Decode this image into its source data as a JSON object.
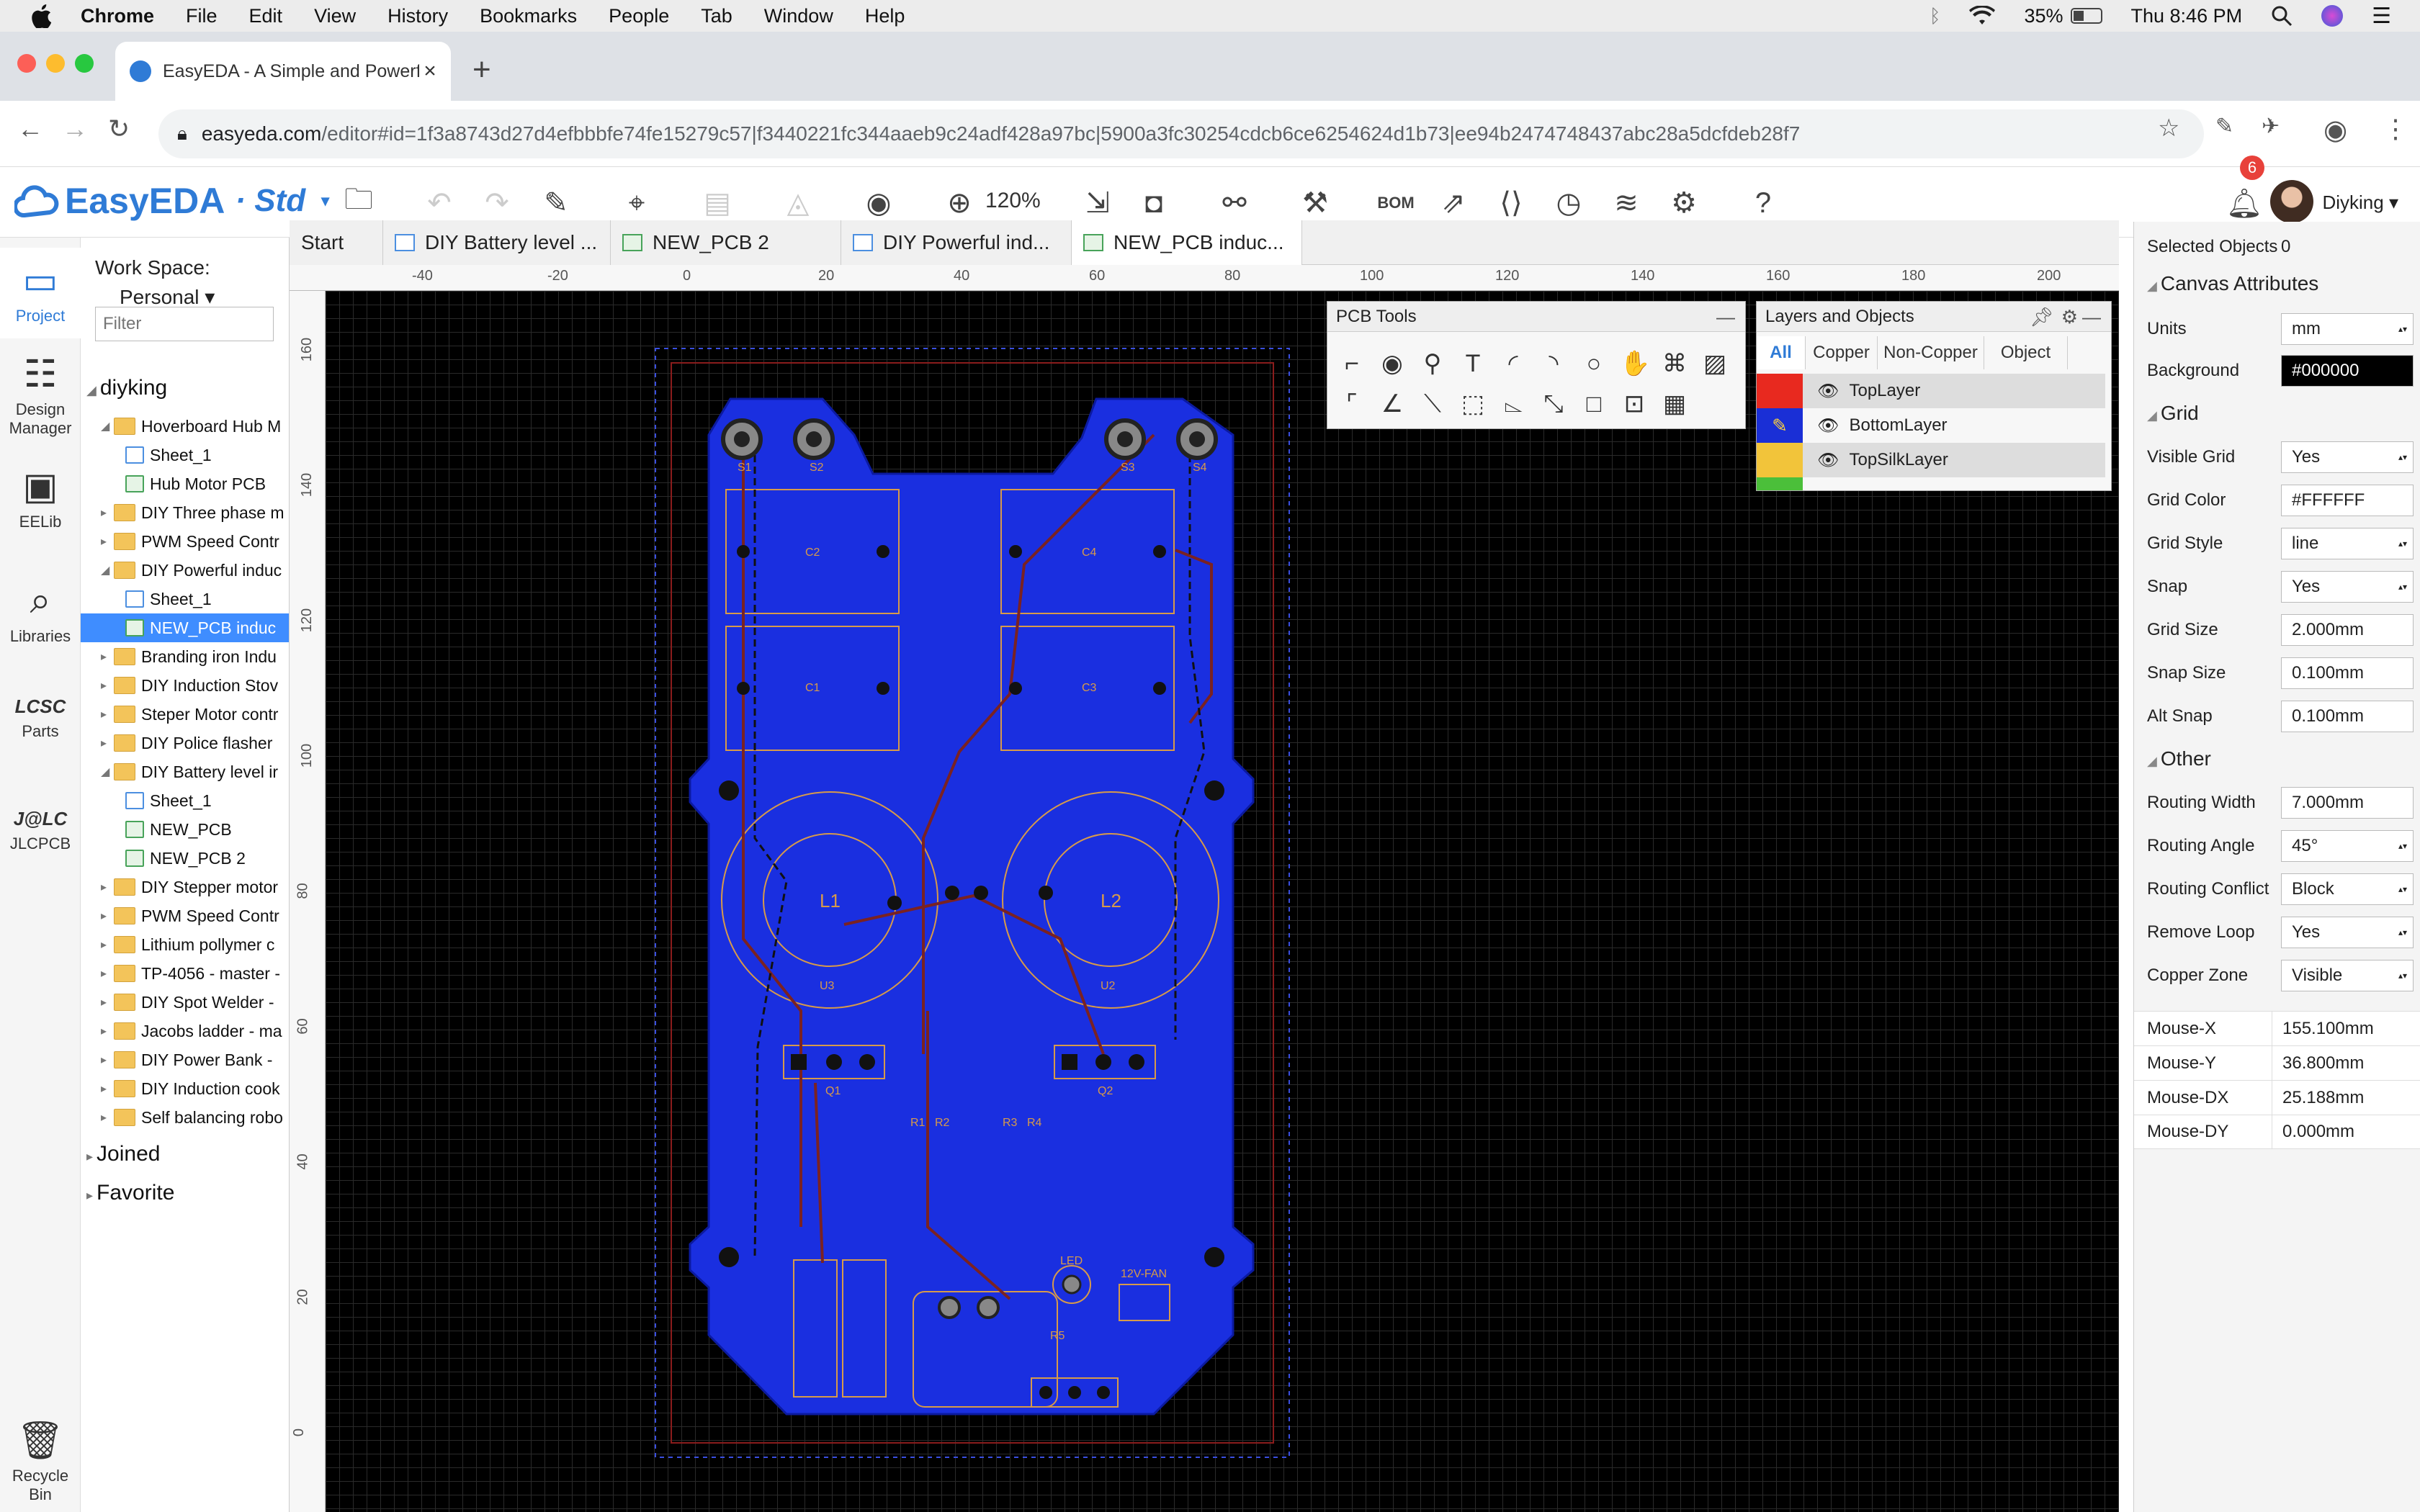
{
  "menubar": {
    "items": [
      "Chrome",
      "File",
      "Edit",
      "View",
      "History",
      "Bookmarks",
      "People",
      "Tab",
      "Window",
      "Help"
    ],
    "battery": "35%",
    "clock": "Thu 8:46 PM"
  },
  "browser": {
    "tab_title": "EasyEDA - A Simple and Powerful",
    "url_host": "easyeda.com",
    "url_path": "/editor#id=1f3a8743d27d4efbbbfe74fe15279c57|f3440221fc344aaeb9c24adf428a97bc|5900a3fc30254cdcb6ce6254624d1b73|ee94b2474748437abc28a5dcfdeb28f7"
  },
  "app": {
    "logo": "EasyEDA",
    "edition": "· Std",
    "zoom": "120%",
    "bom_label": "BOM",
    "notifications": "6",
    "user": "Diyking"
  },
  "rail": [
    {
      "label": "Project",
      "icon": "project-icon"
    },
    {
      "label": "Design Manager",
      "icon": "design-manager-icon"
    },
    {
      "label": "EELib",
      "icon": "eelib-icon"
    },
    {
      "label": "Libraries",
      "icon": "libraries-icon"
    },
    {
      "label": "Parts",
      "icon": "lcsc-icon"
    },
    {
      "label": "JLCPCB",
      "icon": "jlcpcb-icon"
    },
    {
      "label": "Recycle Bin",
      "icon": "trash-icon"
    }
  ],
  "tree": {
    "workspace_label": "Work Space:",
    "workspace": "Personal",
    "filter_placeholder": "Filter",
    "root": "diyking",
    "items": [
      {
        "label": "Hoverboard Hub M",
        "type": "folder",
        "level": 1,
        "open": true
      },
      {
        "label": "Sheet_1",
        "type": "sheet",
        "level": 2
      },
      {
        "label": "Hub Motor PCB",
        "type": "pcb",
        "level": 2
      },
      {
        "label": "DIY Three phase m",
        "type": "folder",
        "level": 1
      },
      {
        "label": "PWM Speed Contr",
        "type": "folder",
        "level": 1
      },
      {
        "label": "DIY Powerful induc",
        "type": "folder",
        "level": 1,
        "open": true
      },
      {
        "label": "Sheet_1",
        "type": "sheet",
        "level": 2
      },
      {
        "label": "NEW_PCB induc",
        "type": "pcb",
        "level": 2,
        "selected": true
      },
      {
        "label": "Branding iron Indu",
        "type": "folder",
        "level": 1
      },
      {
        "label": "DIY Induction Stov",
        "type": "folder",
        "level": 1
      },
      {
        "label": "Steper Motor contr",
        "type": "folder",
        "level": 1
      },
      {
        "label": "DIY Police flasher",
        "type": "folder",
        "level": 1
      },
      {
        "label": "DIY Battery level ir",
        "type": "folder",
        "level": 1,
        "open": true
      },
      {
        "label": "Sheet_1",
        "type": "sheet",
        "level": 2
      },
      {
        "label": "NEW_PCB",
        "type": "pcb",
        "level": 2
      },
      {
        "label": "NEW_PCB 2",
        "type": "pcb",
        "level": 2
      },
      {
        "label": "DIY Stepper motor",
        "type": "folder",
        "level": 1
      },
      {
        "label": "PWM Speed Contr",
        "type": "folder",
        "level": 1
      },
      {
        "label": "Lithium pollymer c",
        "type": "folder",
        "level": 1
      },
      {
        "label": "TP-4056 - master -",
        "type": "folder",
        "level": 1
      },
      {
        "label": "DIY Spot Welder -",
        "type": "folder",
        "level": 1
      },
      {
        "label": "Jacobs ladder - ma",
        "type": "folder",
        "level": 1
      },
      {
        "label": "DIY Power Bank -",
        "type": "folder",
        "level": 1
      },
      {
        "label": "DIY Induction cook",
        "type": "folder",
        "level": 1
      },
      {
        "label": "Self balancing robo",
        "type": "folder",
        "level": 1
      }
    ],
    "joined": "Joined",
    "favorite": "Favorite"
  },
  "doc_tabs": [
    {
      "label": "Start",
      "type": "start"
    },
    {
      "label": "DIY Battery level ...",
      "type": "sheet"
    },
    {
      "label": "NEW_PCB 2",
      "type": "pcb"
    },
    {
      "label": "DIY Powerful ind...",
      "type": "sheet"
    },
    {
      "label": "NEW_PCB induc...",
      "type": "pcb",
      "active": true
    }
  ],
  "rulers": {
    "h": [
      "-40",
      "-20",
      "0",
      "20",
      "40",
      "60",
      "80",
      "100",
      "120",
      "140",
      "160",
      "180",
      "200"
    ],
    "v": [
      "160",
      "140",
      "120",
      "100",
      "80",
      "60",
      "40",
      "20",
      "0"
    ]
  },
  "pcb_tools": {
    "title": "PCB Tools"
  },
  "layers": {
    "title": "Layers and Objects",
    "tabs": [
      "All",
      "Copper",
      "Non-Copper",
      "Object"
    ],
    "rows": [
      {
        "name": "TopLayer",
        "color": "#e8291f"
      },
      {
        "name": "BottomLayer",
        "color": "#1a2fd6"
      },
      {
        "name": "TopSilkLayer",
        "color": "#f2c43a"
      }
    ]
  },
  "board_labels": [
    "S1",
    "S2",
    "S3",
    "S4",
    "C2",
    "C4",
    "C1",
    "C3",
    "L1",
    "L2",
    "U3",
    "U2",
    "Q1",
    "Q2",
    "R1",
    "R2",
    "R3",
    "R4",
    "LED",
    "12V-FAN",
    "R5"
  ],
  "props": {
    "selected_label": "Selected Objects",
    "selected_value": "0",
    "canvas_title": "Canvas Attributes",
    "units_label": "Units",
    "units": "mm",
    "background_label": "Background",
    "background": "#000000",
    "grid_title": "Grid",
    "visible_grid_label": "Visible Grid",
    "visible_grid": "Yes",
    "grid_color_label": "Grid Color",
    "grid_color": "#FFFFFF",
    "grid_style_label": "Grid Style",
    "grid_style": "line",
    "snap_label": "Snap",
    "snap": "Yes",
    "grid_size_label": "Grid Size",
    "grid_size": "2.000mm",
    "snap_size_label": "Snap Size",
    "snap_size": "0.100mm",
    "alt_snap_label": "Alt Snap",
    "alt_snap": "0.100mm",
    "other_title": "Other",
    "routing_width_label": "Routing Width",
    "routing_width": "7.000mm",
    "routing_angle_label": "Routing Angle",
    "routing_angle": "45°",
    "routing_conflict_label": "Routing Conflict",
    "routing_conflict": "Block",
    "remove_loop_label": "Remove Loop",
    "remove_loop": "Yes",
    "copper_zone_label": "Copper Zone",
    "copper_zone": "Visible",
    "mouse_x_label": "Mouse-X",
    "mouse_x": "155.100mm",
    "mouse_y_label": "Mouse-Y",
    "mouse_y": "36.800mm",
    "mouse_dx_label": "Mouse-DX",
    "mouse_dx": "25.188mm",
    "mouse_dy_label": "Mouse-DY",
    "mouse_dy": "0.000mm"
  }
}
